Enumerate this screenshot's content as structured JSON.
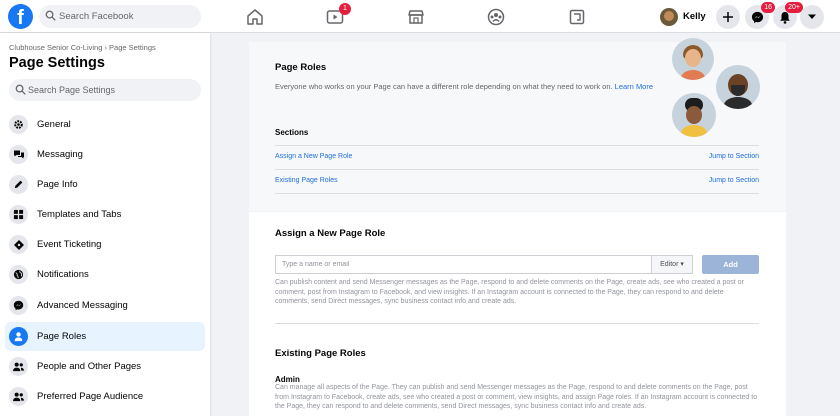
{
  "topbar": {
    "logo": "f",
    "search_placeholder": "Search Facebook",
    "nav": [
      {
        "icon": "home-icon"
      },
      {
        "icon": "watch-icon",
        "badge": "1"
      },
      {
        "icon": "marketplace-icon"
      },
      {
        "icon": "groups-icon"
      },
      {
        "icon": "gaming-icon"
      }
    ],
    "profile_name": "Kelly",
    "messenger_badge": "16",
    "notifications_badge": "20+"
  },
  "sidebar": {
    "breadcrumb": "Clubhouse Senior Co-Living › Page Settings",
    "title": "Page Settings",
    "search_placeholder": "Search Page Settings",
    "items": [
      {
        "label": "General",
        "icon": "gear-icon"
      },
      {
        "label": "Messaging",
        "icon": "speech-bubbles-icon"
      },
      {
        "label": "Page Info",
        "icon": "pencil-icon"
      },
      {
        "label": "Templates and Tabs",
        "icon": "grid-icon"
      },
      {
        "label": "Event Ticketing",
        "icon": "ticket-icon"
      },
      {
        "label": "Notifications",
        "icon": "globe-icon"
      },
      {
        "label": "Advanced Messaging",
        "icon": "messenger-icon"
      },
      {
        "label": "Page Roles",
        "icon": "person-icon",
        "active": true
      },
      {
        "label": "People and Other Pages",
        "icon": "people-icon"
      },
      {
        "label": "Preferred Page Audience",
        "icon": "people-icon"
      }
    ]
  },
  "page_roles": {
    "title": "Page Roles",
    "description": "Everyone who works on your Page can have a different role depending on what they need to work on.",
    "learn_more": "Learn More",
    "sections_label": "Sections",
    "sections": [
      {
        "label": "Assign a New Page Role",
        "jump": "Jump to Section"
      },
      {
        "label": "Existing Page Roles",
        "jump": "Jump to Section"
      }
    ]
  },
  "assign": {
    "title": "Assign a New Page Role",
    "input_placeholder": "Type a name or email",
    "role_value": "Editor ▾",
    "add_label": "Add",
    "description": "Can publish content and send Messenger messages as the Page, respond to and delete comments on the Page, create ads, see who created a post or comment, post from Instagram to Facebook, and view insights. If an Instagram account is connected to the Page, they can respond to and delete comments, send Direct messages, sync business contact info and create ads."
  },
  "existing": {
    "title": "Existing Page Roles",
    "role_name": "Admin",
    "description": "Can manage all aspects of the Page. They can publish and send Messenger messages as the Page, respond to and delete comments on the Page, post from Instagram to Facebook, create ads, see who created a post or comment, view insights, and assign Page roles. If an Instagram account is connected to the Page, they can respond to and delete comments, send Direct messages, sync business contact info and create ads."
  },
  "colors": {
    "brand": "#1877f2",
    "link": "#216fdb",
    "badge": "#e41e3f",
    "active_bg": "#e7f3ff"
  }
}
